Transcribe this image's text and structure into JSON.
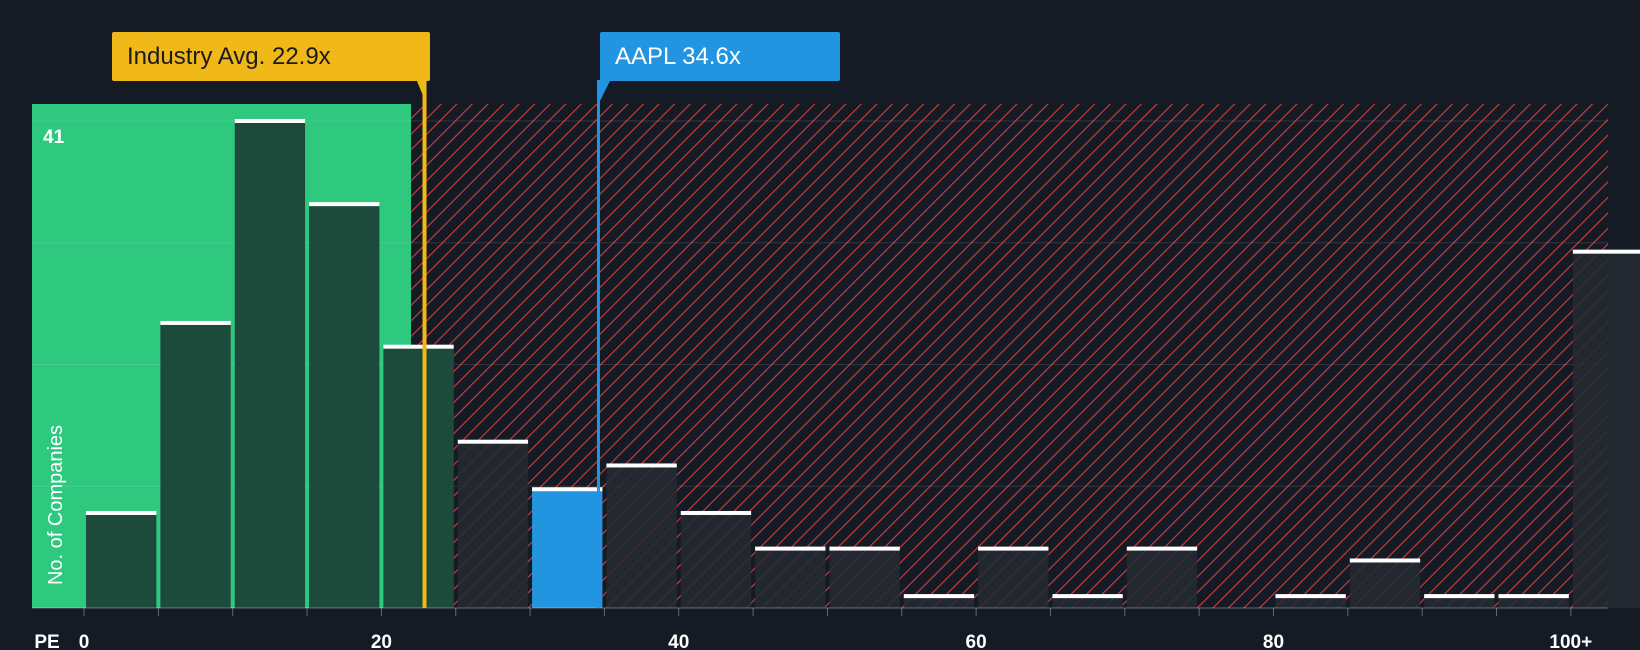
{
  "chart_data": {
    "type": "bar",
    "title": "",
    "xlabel": "PE",
    "ylabel": "No. of Companies",
    "x_tick_labels": [
      "0",
      "20",
      "40",
      "60",
      "80",
      "100+"
    ],
    "x_ticks": [
      0,
      20,
      40,
      60,
      80,
      100
    ],
    "xlim": [
      -3.5,
      102.5
    ],
    "ylim": [
      0,
      43
    ],
    "y_max_label": "41",
    "bin_width": 5,
    "bins": [
      {
        "x0": 0,
        "x1": 5,
        "count": 8
      },
      {
        "x0": 5,
        "x1": 10,
        "count": 24
      },
      {
        "x0": 10,
        "x1": 15,
        "count": 41
      },
      {
        "x0": 15,
        "x1": 20,
        "count": 34
      },
      {
        "x0": 20,
        "x1": 25,
        "count": 22
      },
      {
        "x0": 25,
        "x1": 30,
        "count": 14
      },
      {
        "x0": 30,
        "x1": 35,
        "count": 10
      },
      {
        "x0": 35,
        "x1": 40,
        "count": 12
      },
      {
        "x0": 40,
        "x1": 45,
        "count": 8
      },
      {
        "x0": 45,
        "x1": 50,
        "count": 5
      },
      {
        "x0": 50,
        "x1": 55,
        "count": 5
      },
      {
        "x0": 55,
        "x1": 60,
        "count": 1
      },
      {
        "x0": 60,
        "x1": 65,
        "count": 5
      },
      {
        "x0": 65,
        "x1": 70,
        "count": 1
      },
      {
        "x0": 70,
        "x1": 75,
        "count": 5
      },
      {
        "x0": 75,
        "x1": 80,
        "count": 0
      },
      {
        "x0": 80,
        "x1": 85,
        "count": 1
      },
      {
        "x0": 85,
        "x1": 90,
        "count": 4
      },
      {
        "x0": 90,
        "x1": 95,
        "count": 1
      },
      {
        "x0": 95,
        "x1": 100,
        "count": 1
      },
      {
        "x0": 100,
        "x1": 105,
        "count": 30
      }
    ],
    "industry_avg": {
      "label": "Industry Avg. 22.9x",
      "value": 22.9
    },
    "company": {
      "label": "AAPL 34.6x",
      "value": 34.6
    },
    "fair_zone_end": 22.0,
    "colors": {
      "background": "#151b24",
      "fair_zone": "#2ec87e",
      "bar_in_fair": "#1e4a3c",
      "bar_outside": "#252a33",
      "hatch_line": "#d63c3f",
      "bar_cap": "#ffffff",
      "company_bar": "#2394e0",
      "industry_line": "#f0b818",
      "company_line": "#2394e0",
      "axis_text": "#ffffff"
    }
  }
}
